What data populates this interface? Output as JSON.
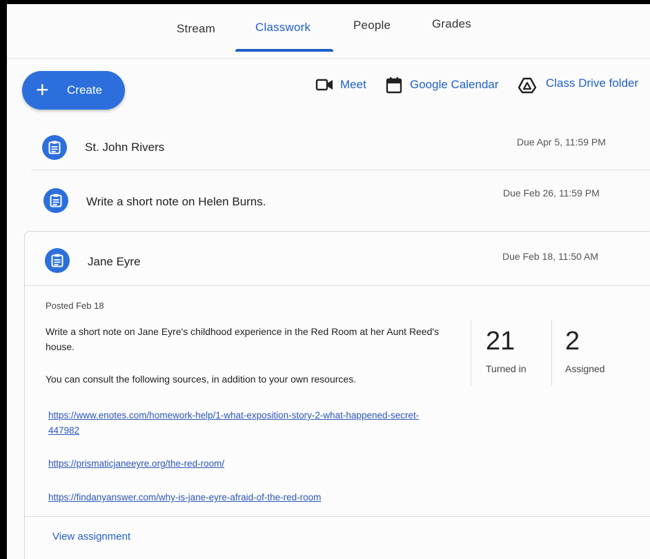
{
  "nav": {
    "tabs": [
      {
        "label": "Stream"
      },
      {
        "label": "Classwork"
      },
      {
        "label": "People"
      },
      {
        "label": "Grades"
      }
    ],
    "active_tab": "Classwork"
  },
  "toolbar": {
    "create_label": "Create",
    "create_icon": "plus-icon",
    "meet_label": "Meet",
    "meet_icon": "video-camera-icon",
    "calendar_label": "Google Calendar",
    "calendar_icon": "calendar-icon",
    "drive_label": "Class Drive folder",
    "drive_icon": "drive-icon"
  },
  "assignments": [
    {
      "title": "St. John Rivers",
      "due": "Due Apr 5, 11:59 PM",
      "icon": "assignment-icon"
    },
    {
      "title": "Write a short note on Helen Burns.",
      "due": "Due Feb 26, 11:59 PM",
      "icon": "assignment-icon"
    },
    {
      "title": "Jane Eyre",
      "due": "Due Feb 18, 11:50 AM",
      "icon": "assignment-icon"
    }
  ],
  "expanded": {
    "posted": "Posted Feb 18",
    "description": "Write a short note on Jane Eyre's childhood experience in the Red Room at her Aunt Reed's house.",
    "description2": "You can consult the following sources, in addition to your own resources.",
    "links": [
      "https://www.enotes.com/homework-help/1-what-exposition-story-2-what-happened-secret-447982",
      "https://prismaticjaneeyre.org/the-red-room/",
      "https://findanyanswer.com/why-is-jane-eyre-afraid-of-the-red-room"
    ],
    "stats": {
      "turned_in_count": "21",
      "turned_in_label": "Turned in",
      "assigned_count": "2",
      "assigned_label": "Assigned"
    },
    "view_label": "View assignment"
  },
  "colors": {
    "accent": "#1f5fc9",
    "button": "#2c6fdc",
    "link": "#2a55b8"
  }
}
